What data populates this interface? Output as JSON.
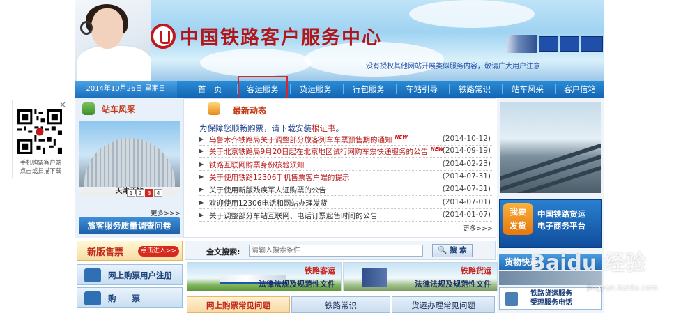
{
  "header": {
    "title": "中国铁路客户服务中心",
    "notice": "没有授权其他网站开展类似服务内容，敬请广大用户注意"
  },
  "nav": {
    "date": "2014年10月26日 星期日",
    "items": [
      "首　页",
      "客运服务",
      "货运服务",
      "行包服务",
      "车站引导",
      "铁路常识",
      "站车风采",
      "客户信箱"
    ]
  },
  "qr": {
    "caption_line1": "手机购票客户端",
    "caption_line2": "点击或扫描下载",
    "close": "×"
  },
  "station_section": {
    "title": "站车风采",
    "caption": "天津西站",
    "pages": [
      "1",
      "2",
      "3",
      "4"
    ],
    "active_page": "3",
    "more": "更多>>>",
    "survey_button": "旅客服务质量调查问卷"
  },
  "news": {
    "title": "最新动态",
    "intro_text": "为保障您顺畅购票，请下载安装",
    "intro_link": "根证书",
    "intro_end": "。",
    "new_badge": "NEW",
    "items": [
      {
        "title": "乌鲁木齐铁路局关于调整部分旅客列车车票预售期的通知",
        "date": "(2014-10-12)",
        "red": true,
        "new": true
      },
      {
        "title": "关于北京铁路局9月20日起在北京地区试行网购车票快递服务的公告",
        "date": "(2014-09-19)",
        "red": true,
        "new": true
      },
      {
        "title": "铁路互联网购票身份核验须知",
        "date": "(2014-02-23)",
        "red": true,
        "new": false
      },
      {
        "title": "关于使用铁路12306手机售票客户端的提示",
        "date": "(2014-07-31)",
        "red": true,
        "new": false
      },
      {
        "title": "关于使用新版残疾军人证购票的公告",
        "date": "(2014-07-31)",
        "red": false,
        "new": false
      },
      {
        "title": "欢迎使用12306电话和网站办理发货",
        "date": "(2014-07-01)",
        "red": false,
        "new": false
      },
      {
        "title": "关于调整部分车站互联网、电话订票起售时间的公告",
        "date": "(2014-01-07)",
        "red": false,
        "new": false
      }
    ],
    "more": "更多>>>"
  },
  "freight_box": {
    "badge_line1": "我要",
    "badge_line2": "发货",
    "line1": "中国铁路货运",
    "line2": "电子商务平台"
  },
  "right_column": {
    "cargo_title": "货物快运",
    "hotline_line1": "铁路货运服务",
    "hotline_line2": "受理服务电话"
  },
  "left_bottom": {
    "new_ticket": "新版售票",
    "enter": "点击进入>>",
    "register": "网上购票用户注册",
    "buy": "购　　票"
  },
  "search": {
    "label": "全文搜索:",
    "placeholder": "请输入搜索条件",
    "button": "搜 索"
  },
  "promos": [
    {
      "line1": "铁路客运",
      "line2": "法律法规及规范性文件"
    },
    {
      "line1": "铁路货运",
      "line2": "法律法规及规范性文件"
    }
  ],
  "tabs": [
    "网上购票常见问题",
    "铁路常识",
    "货运办理常见问题"
  ],
  "watermark": {
    "brand": "Baidu 经验",
    "url": "jingyan.baidu.com"
  },
  "colors": {
    "brand_red": "#b0161a",
    "nav_blue": "#1466b4",
    "highlight_box": "#d8262c"
  }
}
